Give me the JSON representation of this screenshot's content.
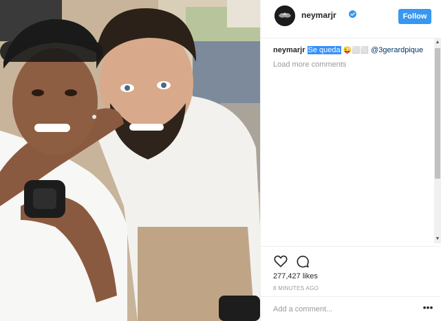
{
  "post": {
    "photo_icon": "photo-two-men-selfie",
    "header": {
      "avatar_icon": "avatar-logo-icon",
      "username": "neymarjr",
      "verified_icon": "verified-badge-icon",
      "follow_label": "Follow"
    },
    "caption": {
      "username": "neymarjr",
      "highlighted_text": "Se queda",
      "emoji": "😜⬜⬜",
      "mention": "@3gerardpique"
    },
    "load_more_label": "Load more comments",
    "actions": {
      "like_icon": "heart-icon",
      "comment_icon": "comment-bubble-icon",
      "likes_text": "277,427 likes",
      "time_text": "8 MINUTES AGO"
    },
    "comment_box": {
      "placeholder": "Add a comment...",
      "value": "",
      "more_label": "•••"
    }
  },
  "colors": {
    "follow_button": "#3897f0",
    "highlight": "#3390ff",
    "mention": "#003569",
    "muted": "#999999",
    "text": "#262626"
  }
}
